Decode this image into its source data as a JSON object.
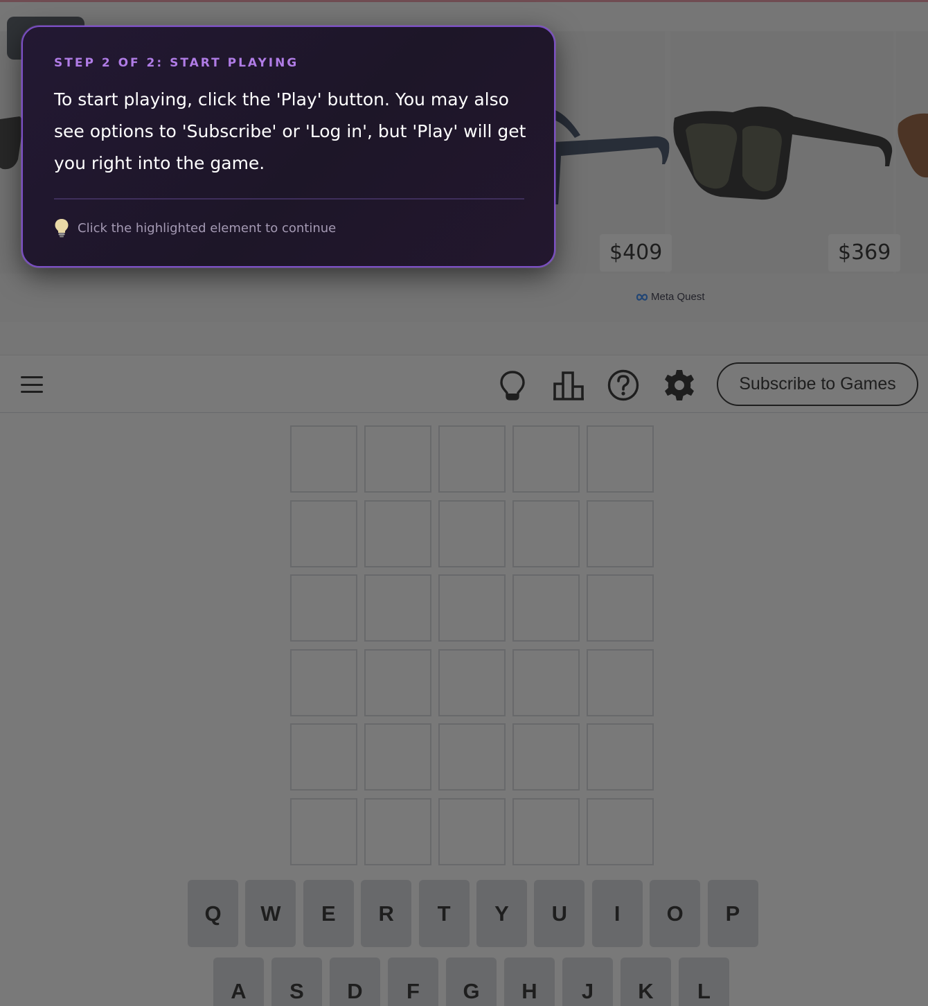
{
  "ad": {
    "prices": [
      "$409",
      "$369"
    ],
    "brand": "Meta Quest"
  },
  "header": {
    "subscribe_label": "Subscribe to Games"
  },
  "board": {
    "rows": 6,
    "cols": 5
  },
  "keyboard": {
    "row1": [
      "Q",
      "W",
      "E",
      "R",
      "T",
      "Y",
      "U",
      "I",
      "O",
      "P"
    ],
    "row2": [
      "A",
      "S",
      "D",
      "F",
      "G",
      "H",
      "J",
      "K",
      "L"
    ]
  },
  "tutorial": {
    "step": "STEP 2 OF 2: START PLAYING",
    "body": "To start playing, click the 'Play' button. You may also see options to 'Subscribe' or 'Log in', but 'Play' will get you right into the game.",
    "hint": "Click the highlighted element to continue",
    "hint_icon": "lightbulb-icon"
  },
  "colors": {
    "tile_border": "#d3d6da",
    "key_bg": "#d3d6da",
    "tutorial_accent": "#b07ce6",
    "tutorial_border": "#7b4ec4"
  }
}
